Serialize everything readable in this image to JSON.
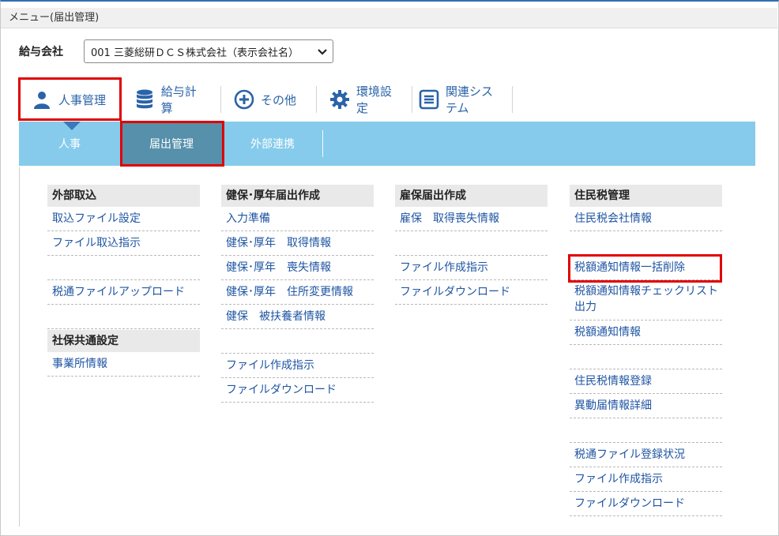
{
  "window": {
    "title": "メニュー(届出管理)"
  },
  "company": {
    "label": "給与会社",
    "selected": "001 三菱総研ＤＣＳ株式会社（表示会社名）"
  },
  "main_nav": {
    "items": [
      {
        "label": "人事管理",
        "icon": "person-icon"
      },
      {
        "label": "給与計算",
        "icon": "database-icon"
      },
      {
        "label": "その他",
        "icon": "plus-circle-icon"
      },
      {
        "label": "環境設定",
        "icon": "gear-icon"
      },
      {
        "label": "関連システム",
        "icon": "list-icon"
      }
    ]
  },
  "sub_nav": {
    "items": [
      {
        "label": "人事"
      },
      {
        "label": "届出管理"
      },
      {
        "label": "外部連携"
      }
    ]
  },
  "columns": [
    {
      "sections": [
        {
          "title": "外部取込",
          "links": [
            "取込ファイル設定",
            "ファイル取込指示",
            "",
            "税通ファイルアップロード",
            ""
          ]
        },
        {
          "title": "社保共通設定",
          "links": [
            "事業所情報"
          ]
        }
      ]
    },
    {
      "sections": [
        {
          "title": "健保･厚年届出作成",
          "links": [
            "入力準備",
            "健保･厚年　取得情報",
            "健保･厚年　喪失情報",
            "健保･厚年　住所変更情報",
            "健保　被扶養者情報",
            "",
            "ファイル作成指示",
            "ファイルダウンロード"
          ]
        }
      ]
    },
    {
      "sections": [
        {
          "title": "雇保届出作成",
          "links": [
            "雇保　取得喪失情報",
            "",
            "ファイル作成指示",
            "ファイルダウンロード"
          ]
        }
      ]
    },
    {
      "sections": [
        {
          "title": "住民税管理",
          "links": [
            "住民税会社情報",
            "",
            "税額通知情報一括削除",
            "税額通知情報チェックリスト出力",
            "税額通知情報",
            "",
            "住民税情報登録",
            "異動届情報詳細",
            "",
            "税通ファイル登録状況",
            "ファイル作成指示",
            "ファイルダウンロード"
          ]
        }
      ]
    }
  ],
  "colors": {
    "accent": "#2a63a8",
    "subnav_bg": "#86cbeb",
    "subnav_active": "#5690ab",
    "highlight": "#e10000"
  }
}
